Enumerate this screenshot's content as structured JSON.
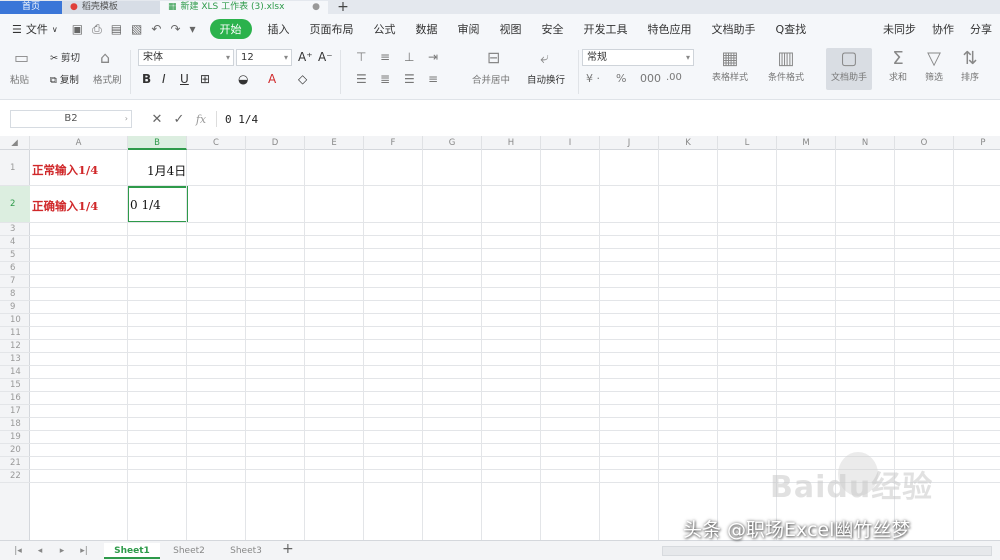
{
  "titlebar": {
    "tabs": [
      {
        "label": "首页",
        "kind": "home"
      },
      {
        "label": "稻壳模板",
        "kind": "doc"
      },
      {
        "label": "新建 XLS 工作表 (3).xlsx",
        "kind": "active"
      }
    ],
    "add_label": "+"
  },
  "menubar": {
    "file_label": "文件",
    "tabs": [
      "开始",
      "插入",
      "页面布局",
      "公式",
      "数据",
      "审阅",
      "视图",
      "安全",
      "开发工具",
      "特色应用",
      "文档助手"
    ],
    "search_label": "Q查找",
    "right": [
      "未同步",
      "协作",
      "分享"
    ]
  },
  "ribbon": {
    "paste_label": "粘贴",
    "cut_label": "剪切",
    "copy_label": "复制",
    "format_painter_label": "格式刷",
    "font_name": "宋体",
    "font_size": "12",
    "bold": "B",
    "italic": "I",
    "underline": "U",
    "merge_label": "合并居中",
    "wrap_label": "自动换行",
    "number_format": "常规",
    "table_style_label": "表格样式",
    "cond_format_label": "条件格式",
    "text_format_label": "文档助手",
    "sum_label": "求和",
    "filter_label": "筛选",
    "sort_label": "排序"
  },
  "formula_bar": {
    "name_box": "B2",
    "fx_label": "fx",
    "content": "0 1/4"
  },
  "grid": {
    "columns": [
      "A",
      "B",
      "C",
      "D",
      "E",
      "F",
      "G",
      "H",
      "I",
      "J",
      "K",
      "L",
      "M",
      "N",
      "O",
      "P"
    ],
    "rows": [
      "1",
      "2",
      "3",
      "4",
      "5",
      "6",
      "7",
      "8",
      "9",
      "10",
      "11",
      "12",
      "13",
      "14",
      "15",
      "16",
      "17",
      "18",
      "19",
      "20",
      "21",
      "22"
    ],
    "a1": "正常输入1/4",
    "b1": "1月4日",
    "a2": "正确输入1/4",
    "b2": "0 1/4",
    "selected_col": "B",
    "selected_row": "2"
  },
  "sheets": [
    "Sheet1",
    "Sheet2",
    "Sheet3"
  ],
  "watermarks": {
    "baidu": "Baidu经验",
    "toutiao": "头条 @职场Excel幽竹丝梦"
  }
}
